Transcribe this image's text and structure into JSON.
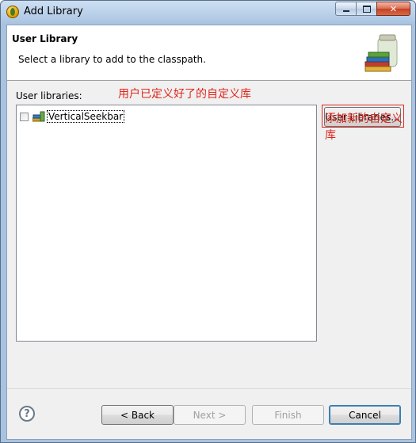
{
  "window": {
    "title": "Add Library",
    "close_glyph": "✕"
  },
  "banner": {
    "title": "User Library",
    "description": "Select a library to add to the classpath."
  },
  "libraries": {
    "label": "User libraries:",
    "items": [
      {
        "name": "VerticalSeekbar",
        "checked": false
      }
    ],
    "user_libraries_button": "User Libraries..."
  },
  "annotations": {
    "item_note": "用户已定义好了的自定义库",
    "button_note": "添加新的自定义库",
    "color": "#e0261c"
  },
  "footer": {
    "help_glyph": "?",
    "back": "< Back",
    "next": "Next >",
    "finish": "Finish",
    "cancel": "Cancel"
  },
  "icons": [
    "eclipse-app-icon",
    "library-jar-icon",
    "books-icon",
    "help-icon"
  ]
}
